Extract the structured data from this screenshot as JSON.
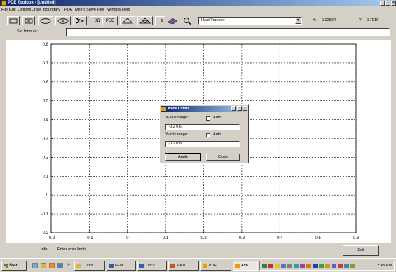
{
  "window": {
    "title": "PDE Toolbox - [Untitled]"
  },
  "menu": [
    "File",
    "Edit",
    "Options",
    "Draw",
    "Boundary",
    "PDE",
    "Mesh",
    "Solve",
    "Plot",
    "Window",
    "Help"
  ],
  "toolbar": {
    "pde_label": "PDE",
    "omega_label": "∂Ω",
    "equals_label": "=",
    "app_mode": "Heat Transfer",
    "x_label": "X:",
    "x_value": "-0.02864",
    "y_label": "Y:",
    "y_value": "0.7916"
  },
  "formula": {
    "label": "Set formula:",
    "value": ""
  },
  "axes": {
    "x_ticks": [
      "-0.2",
      "-0.1",
      "0",
      "0.1",
      "0.2",
      "0.3",
      "0.4",
      "0.5",
      "0.6"
    ],
    "y_ticks": [
      "-0.2",
      "-0.1",
      "0",
      "0.1",
      "0.2",
      "0.3",
      "0.4",
      "0.5",
      "0.6",
      "0.7",
      "0.8"
    ],
    "x_range": [
      -0.2,
      0.6
    ],
    "y_range": [
      -0.2,
      0.8
    ],
    "grid": true
  },
  "dialog": {
    "title": "Axes Limits",
    "x_range_label": "X-axis range:",
    "x_auto_label": "Auto",
    "x_auto_checked": false,
    "x_value": "[-0.2 0.6]",
    "y_range_label": "Y-axis range:",
    "y_auto_label": "Auto",
    "y_auto_checked": false,
    "y_value": "[-0.2 0.8]",
    "apply_label": "Apply",
    "close_label": "Close"
  },
  "status": {
    "info_label": "Info:",
    "info_text": "Enter axes limits.",
    "exit_label": "Exit"
  },
  "taskbar": {
    "start_label": "Start",
    "chevron": "»",
    "tasks": [
      {
        "label": "Curso...",
        "active": false
      },
      {
        "label": "FEM ...",
        "active": false
      },
      {
        "label": "Docu...",
        "active": false
      },
      {
        "label": "MATL...",
        "active": false
      },
      {
        "label": "PDE ...",
        "active": false
      },
      {
        "label": "Axe...",
        "active": true
      }
    ],
    "clock": "12:43 PM"
  }
}
